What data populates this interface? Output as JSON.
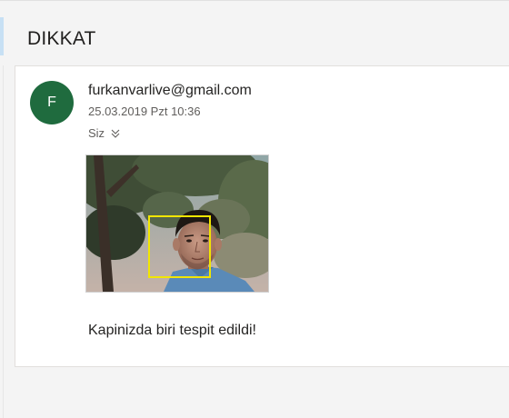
{
  "message": {
    "subject": "DIKKAT",
    "sender": {
      "initial": "F",
      "email": "furkanvarlive@gmail.com",
      "avatar_color": "#1f6b3e"
    },
    "datetime": "25.03.2019 Pzt 10:36",
    "recipients_label": "Siz",
    "recipients_icon": "chevron-down-double-icon",
    "body": "Kapinizda biri tespit edildi!",
    "attachment": {
      "kind": "photo",
      "subject": "face detection capture",
      "face_box_color": "#f2e600"
    }
  }
}
